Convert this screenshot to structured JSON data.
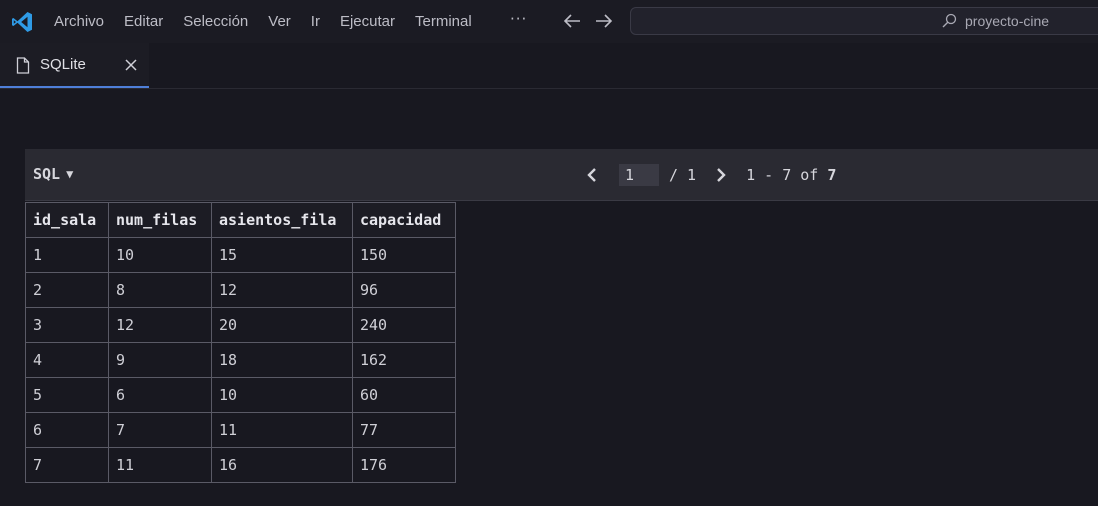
{
  "titlebar": {
    "menu": [
      "Archivo",
      "Editar",
      "Selección",
      "Ver",
      "Ir",
      "Ejecutar",
      "Terminal"
    ],
    "more": "···",
    "search_text": "proyecto-cine"
  },
  "tab": {
    "label": "SQLite"
  },
  "toolbar": {
    "sql_label": "SQL",
    "caret": "▼",
    "page_value": "1",
    "page_total": "/ 1",
    "range_prefix": "1 - 7 of ",
    "range_total": "7"
  },
  "table": {
    "columns": [
      "id_sala",
      "num_filas",
      "asientos_fila",
      "capacidad"
    ],
    "rows": [
      [
        "1",
        "10",
        "15",
        "150"
      ],
      [
        "2",
        "8",
        "12",
        "96"
      ],
      [
        "3",
        "12",
        "20",
        "240"
      ],
      [
        "4",
        "9",
        "18",
        "162"
      ],
      [
        "5",
        "6",
        "10",
        "60"
      ],
      [
        "6",
        "7",
        "11",
        "77"
      ],
      [
        "7",
        "11",
        "16",
        "176"
      ]
    ]
  },
  "colors": {
    "accent": "#4f7fd8",
    "vscode_logo": "#2f9be6",
    "background": "#181820"
  }
}
